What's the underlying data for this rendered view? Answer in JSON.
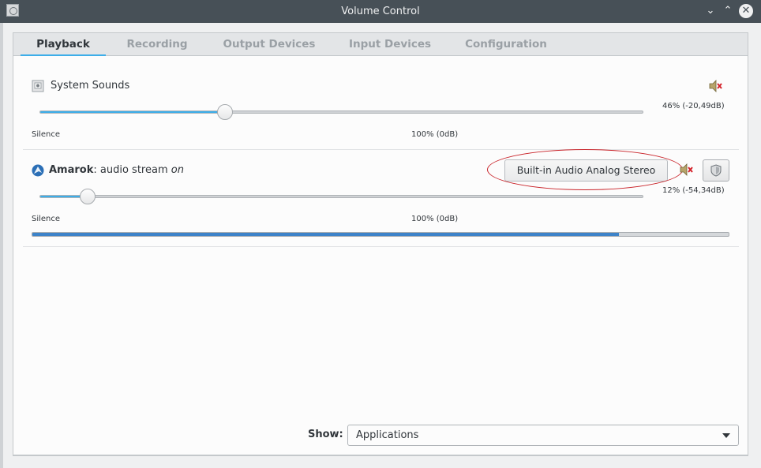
{
  "window": {
    "title": "Volume Control",
    "buttons": {
      "minimize": "⌄",
      "maximize": "⌃",
      "close": "✕"
    }
  },
  "tabs": [
    {
      "label": "Playback",
      "active": true
    },
    {
      "label": "Recording",
      "active": false
    },
    {
      "label": "Output Devices",
      "active": false
    },
    {
      "label": "Input Devices",
      "active": false
    },
    {
      "label": "Configuration",
      "active": false
    }
  ],
  "streams": [
    {
      "name": "System Sounds",
      "volume_percent": 46,
      "volume_text": "46% (-20,49dB)",
      "silence_label": "Silence",
      "mark_label": "100% (0dB)",
      "muted_icon": "speaker-muted-icon"
    },
    {
      "app": "Amarok",
      "separator": ": ",
      "stream": "audio stream ",
      "state": "on",
      "volume_percent": 12,
      "volume_text": "12% (-54,34dB)",
      "silence_label": "Silence",
      "mark_label": "100% (0dB)",
      "device": "Built-in Audio Analog Stereo",
      "level_fraction": 0.84,
      "muted_icon": "speaker-muted-icon",
      "lock_icon": "shield-lock-icon"
    }
  ],
  "footer": {
    "show_label": "Show:",
    "show_value": "Applications"
  },
  "colors": {
    "accent": "#3daee9",
    "level": "#3d83c9",
    "annotation": "#c9252b",
    "titlebar": "#475057"
  }
}
